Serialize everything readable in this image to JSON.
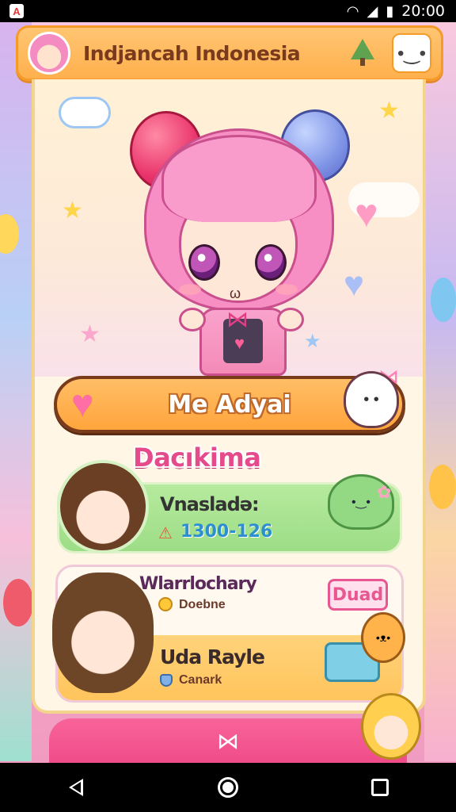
{
  "status_bar": {
    "time": "20:00",
    "icons": [
      "wifi-icon",
      "signal-icon",
      "battery-icon"
    ]
  },
  "header": {
    "title": "Indjancah Indonesia",
    "icons": [
      "avatar",
      "tree-icon",
      "face-icon"
    ]
  },
  "action_banner": {
    "label": "Me Adyai"
  },
  "section": {
    "heading": "Dacıkima"
  },
  "card1": {
    "title": "Vnasladə:",
    "value": "1300-126"
  },
  "card2": {
    "header": "Wlarrlochary",
    "sub1": "Doebne",
    "badge": "Duad",
    "title": "Uda Rayle",
    "sub2": "Canark"
  },
  "bottom_bar": {
    "icon": "bowtie-icon"
  },
  "colors": {
    "header_bg": "#ffb04d",
    "action_bg": "#ffa53c",
    "accent_pink": "#e54b8b",
    "card1_bg": "#9ddd86",
    "card2_bg": "#ffc35a",
    "bottom_bar": "#ef4c88"
  }
}
